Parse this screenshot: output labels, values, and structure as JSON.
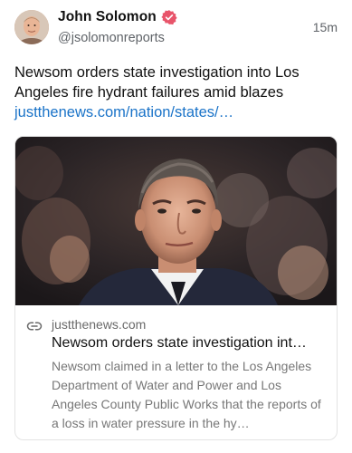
{
  "author": {
    "name": "John Solomon",
    "handle": "@jsolomonreports",
    "verified": true,
    "verified_color": "#e8546a"
  },
  "timestamp": "15m",
  "post": {
    "text": "Newsom orders state investigation into Los Angeles fire hydrant failures amid blazes",
    "link_text": "justthenews.com/nation/states/…",
    "link_color": "#1a73c8"
  },
  "card": {
    "domain": "justthenews.com",
    "title": "Newsom orders state investigation int…",
    "description": "Newsom claimed in a letter to the Los Angeles Department of Water and Power and Los Angeles County Public Works that the reports of a loss in water pressure in the hy…",
    "icon": "link-icon"
  }
}
